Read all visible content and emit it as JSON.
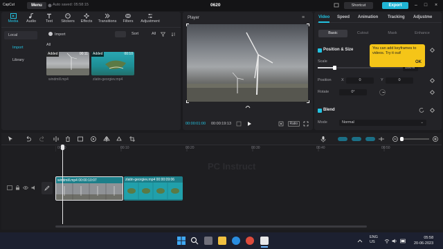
{
  "titlebar": {
    "logo": "CapCut",
    "menu_label": "Menu",
    "autosave": "Auto saved: 05:58:15",
    "project_name": "0620",
    "shortcut_label": "Shortcut",
    "export_label": "Export"
  },
  "toolbar": {
    "items": [
      {
        "label": "Media",
        "icon": "media-icon"
      },
      {
        "label": "Audio",
        "icon": "audio-icon"
      },
      {
        "label": "Text",
        "icon": "text-icon"
      },
      {
        "label": "Stickers",
        "icon": "stickers-icon"
      },
      {
        "label": "Effects",
        "icon": "effects-icon"
      },
      {
        "label": "Transitions",
        "icon": "transitions-icon"
      },
      {
        "label": "Filters",
        "icon": "filters-icon"
      },
      {
        "label": "Adjustment",
        "icon": "adjustment-icon"
      }
    ]
  },
  "media": {
    "sidebar": [
      "Local",
      "Import",
      "Library"
    ],
    "import_label": "Import",
    "sort_label": "Sort",
    "all_filter": "All",
    "all_label": "All",
    "clips": [
      {
        "badge": "Added",
        "duration": "00:11",
        "name": "windmill.mp4"
      },
      {
        "badge": "Added",
        "duration": "00:10",
        "name": "zlatin-georgiev.mp4"
      }
    ]
  },
  "player": {
    "title": "Player",
    "current_time": "00:00:01:00",
    "total_time": "00:00:19:13",
    "ratio_label": "Ratio"
  },
  "inspector": {
    "tabs": [
      "Video",
      "Speed",
      "Animation",
      "Tracking",
      "Adjustme"
    ],
    "subtabs": [
      "Basic",
      "Cutout",
      "Mask",
      "Enhance"
    ],
    "position_size": "Position & Size",
    "scale_label": "Scale",
    "scale_value": "100%",
    "position_label": "Position",
    "pos_x_label": "X",
    "pos_x": "0",
    "pos_y_label": "Y",
    "pos_y": "0",
    "rotate_label": "Rotate",
    "rotate_value": "0°",
    "blend_label": "Blend",
    "mode_label": "Mode",
    "mode_value": "Normal",
    "tooltip_text": "You can add keyframes to videos. Try it out!",
    "tooltip_ok": "OK"
  },
  "timeline": {
    "ruler": [
      "00:00",
      "00:10",
      "00:20",
      "00:30",
      "00:40",
      "00:50"
    ],
    "watermark": "PC Instruct",
    "clips": [
      {
        "label": "windmill.mp4  00:00:10:07"
      },
      {
        "label": "zlatin-georgiev.mp4  00:00:09:06"
      }
    ]
  },
  "taskbar": {
    "lang": "ENG",
    "region": "US",
    "time": "05:58",
    "date": "20-06-2023"
  },
  "colors": {
    "accent": "#23c3e2",
    "tooltip": "#f5c518",
    "clip_teal": "#1c7f8a"
  }
}
